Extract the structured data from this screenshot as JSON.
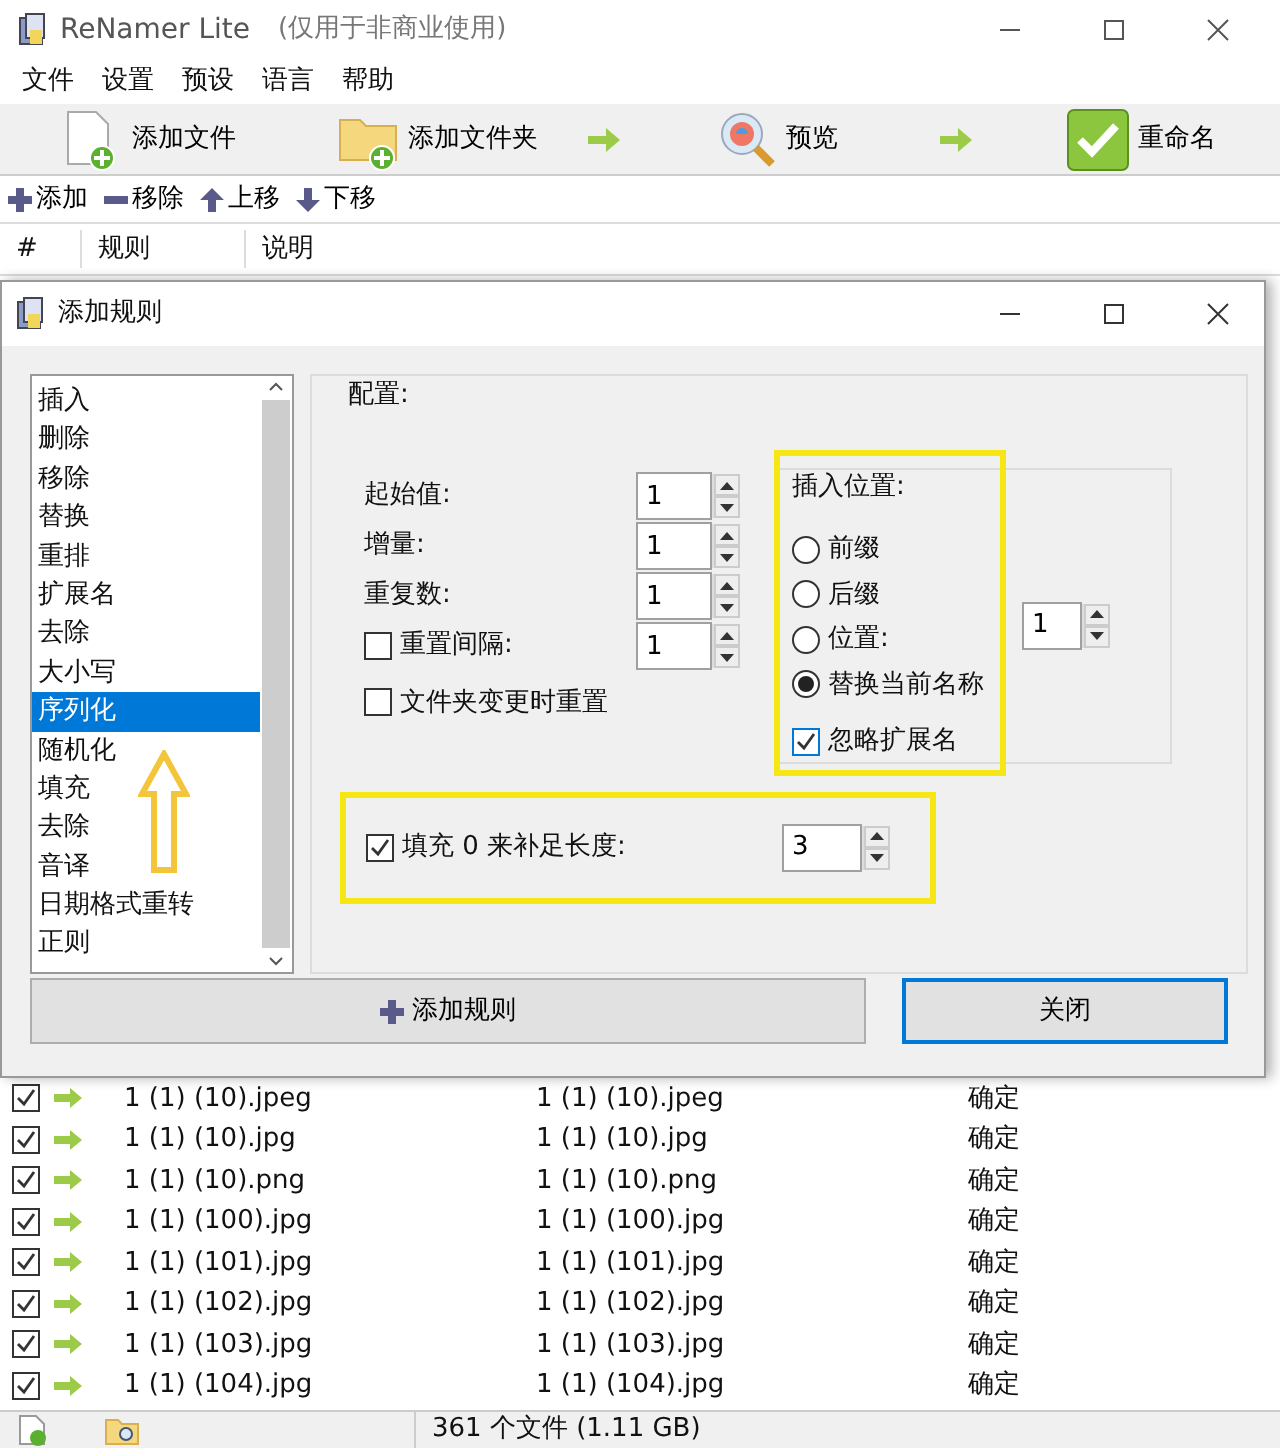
{
  "window": {
    "title": "ReNamer Lite",
    "subtitle": "(仅用于非商业使用)"
  },
  "menu": [
    "文件",
    "设置",
    "预设",
    "语言",
    "帮助"
  ],
  "toolbar": [
    {
      "label": "添加文件",
      "kind": "add-file"
    },
    {
      "label": "添加文件夹",
      "kind": "add-folder"
    },
    {
      "label": "预览",
      "kind": "preview"
    },
    {
      "label": "重命名",
      "kind": "rename"
    }
  ],
  "rule_toolbar": [
    {
      "label": "添加",
      "kind": "add"
    },
    {
      "label": "移除",
      "kind": "remove"
    },
    {
      "label": "上移",
      "kind": "up"
    },
    {
      "label": "下移",
      "kind": "down"
    }
  ],
  "rules_table": {
    "columns": [
      "#",
      "规则",
      "说明"
    ]
  },
  "dialog": {
    "title": "添加规则",
    "rule_list": [
      {
        "label": "插入",
        "selected": false
      },
      {
        "label": "删除",
        "selected": false
      },
      {
        "label": "移除",
        "selected": false
      },
      {
        "label": "替换",
        "selected": false
      },
      {
        "label": "重排",
        "selected": false
      },
      {
        "label": "扩展名",
        "selected": false
      },
      {
        "label": "去除",
        "selected": false
      },
      {
        "label": "大小写",
        "selected": false
      },
      {
        "label": "序列化",
        "selected": true
      },
      {
        "label": "随机化",
        "selected": false
      },
      {
        "label": "填充",
        "selected": false
      },
      {
        "label": "去除",
        "selected": false
      },
      {
        "label": "音译",
        "selected": false
      },
      {
        "label": "日期格式重转",
        "selected": false
      },
      {
        "label": "正则",
        "selected": false
      }
    ],
    "config": {
      "title": "配置:",
      "fields": [
        {
          "label": "起始值:",
          "value": "1",
          "kind": "spin"
        },
        {
          "label": "增量:",
          "value": "1",
          "kind": "spin"
        },
        {
          "label": "重复数:",
          "value": "1",
          "kind": "spin"
        },
        {
          "label": "重置间隔:",
          "value": "1",
          "kind": "check-spin",
          "checked": false
        }
      ],
      "reset_on_folder": {
        "label": "文件夹变更时重置",
        "checked": false
      },
      "insert_position": {
        "title": "插入位置:",
        "options": [
          {
            "label": "前缀",
            "selected": false
          },
          {
            "label": "后缀",
            "selected": false
          },
          {
            "label": "位置:",
            "selected": false
          },
          {
            "label": "替换当前名称",
            "selected": true
          }
        ],
        "position_value": "1",
        "ignore_extension": {
          "label": "忽略扩展名",
          "checked": true
        }
      },
      "pad": {
        "label": "填充 0 来补足长度:",
        "checked": true,
        "value": "3"
      }
    },
    "buttons": [
      {
        "label": "添加规则",
        "kind": "add"
      },
      {
        "label": "关闭",
        "kind": "close"
      }
    ]
  },
  "files": [
    {
      "checked": true,
      "name": "1 (1) (10).jpeg",
      "new_name": "1 (1) (10).jpeg",
      "status": "确定"
    },
    {
      "checked": true,
      "name": "1 (1) (10).jpg",
      "new_name": "1 (1) (10).jpg",
      "status": "确定"
    },
    {
      "checked": true,
      "name": "1 (1) (10).png",
      "new_name": "1 (1) (10).png",
      "status": "确定"
    },
    {
      "checked": true,
      "name": "1 (1) (100).jpg",
      "new_name": "1 (1) (100).jpg",
      "status": "确定"
    },
    {
      "checked": true,
      "name": "1 (1) (101).jpg",
      "new_name": "1 (1) (101).jpg",
      "status": "确定"
    },
    {
      "checked": true,
      "name": "1 (1) (102).jpg",
      "new_name": "1 (1) (102).jpg",
      "status": "确定"
    },
    {
      "checked": true,
      "name": "1 (1) (103).jpg",
      "new_name": "1 (1) (103).jpg",
      "status": "确定"
    },
    {
      "checked": true,
      "name": "1 (1) (104).jpg",
      "new_name": "1 (1) (104).jpg",
      "status": "确定"
    }
  ],
  "status_bar": {
    "text": "361 个文件 (1.11 GB)"
  }
}
